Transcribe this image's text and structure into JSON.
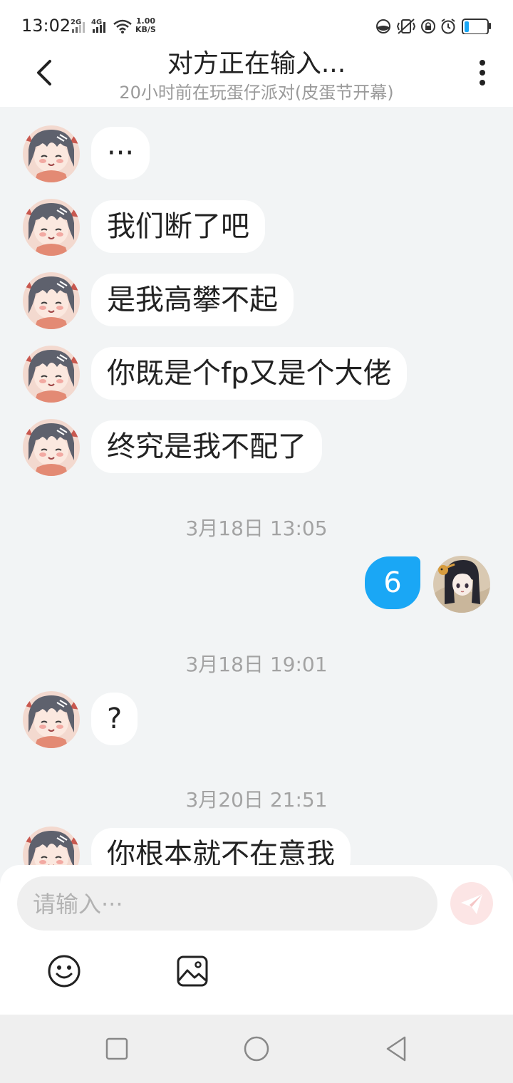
{
  "status_bar": {
    "time": "13:02",
    "signal_1": "2G",
    "signal_2": "4G",
    "net_speed_value": "1.00",
    "net_speed_unit": "KB/S",
    "battery_level": 0.2
  },
  "header": {
    "title": "对方正在输入...",
    "subtitle": "20小时前在玩蛋仔派对(皮蛋节开幕)"
  },
  "messages": [
    {
      "from": "other",
      "text": "···"
    },
    {
      "from": "other",
      "text": "我们断了吧"
    },
    {
      "from": "other",
      "text": "是我高攀不起"
    },
    {
      "from": "other",
      "text": "你既是个fp又是个大佬"
    },
    {
      "from": "other",
      "text": "终究是我不配了"
    },
    {
      "type": "time",
      "text": "3月18日 13:05"
    },
    {
      "from": "me",
      "text": "6"
    },
    {
      "type": "time",
      "text": "3月18日 19:01"
    },
    {
      "from": "other",
      "text": "?"
    },
    {
      "type": "time",
      "text": "3月20日 21:51"
    },
    {
      "from": "other",
      "text": "你根本就不在意我"
    }
  ],
  "input": {
    "placeholder": "请输入···",
    "value": ""
  },
  "icons": {
    "back": "chevron-left-icon",
    "more": "more-vertical-icon",
    "send": "send-icon",
    "emoji": "emoji-icon",
    "image": "image-icon",
    "nav_recent": "recent-apps-icon",
    "nav_home": "home-icon",
    "nav_back": "nav-back-icon"
  },
  "colors": {
    "outgoing_bubble": "#1aa7f5",
    "send_button": "#fce5e5",
    "background": "#f2f4f5"
  }
}
